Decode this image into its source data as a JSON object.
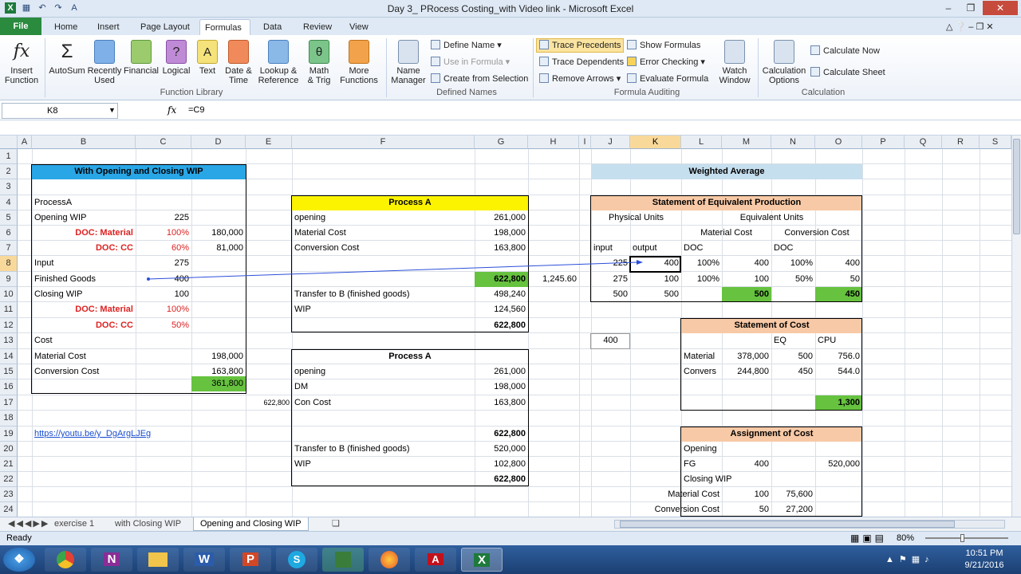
{
  "title": "Day 3_ PRocess Costing_with Video link - Microsoft Excel",
  "tabs": {
    "file": "File",
    "home": "Home",
    "insert": "Insert",
    "page_layout": "Page Layout",
    "formulas": "Formulas",
    "data": "Data",
    "review": "Review",
    "view": "View"
  },
  "ribbon": {
    "insert_function": "Insert\nFunction",
    "autosum": "AutoSum",
    "recently_used": "Recently\nUsed",
    "financial": "Financial",
    "logical": "Logical",
    "text": "Text",
    "date_time": "Date &\nTime",
    "lookup_ref": "Lookup &\nReference",
    "math_trig": "Math\n& Trig",
    "more_functions": "More\nFunctions",
    "name_manager": "Name\nManager",
    "define_name": "Define Name",
    "use_in_formula": "Use in Formula",
    "create_from_selection": "Create from Selection",
    "trace_precedents": "Trace Precedents",
    "trace_dependents": "Trace Dependents",
    "remove_arrows": "Remove Arrows",
    "show_formulas": "Show Formulas",
    "error_checking": "Error Checking",
    "evaluate_formula": "Evaluate Formula",
    "watch_window": "Watch\nWindow",
    "calc_options": "Calculation\nOptions",
    "calculate_now": "Calculate Now",
    "calculate_sheet": "Calculate Sheet",
    "grp_function_library": "Function Library",
    "grp_defined_names": "Defined Names",
    "grp_formula_auditing": "Formula Auditing",
    "grp_calculation": "Calculation"
  },
  "formula_bar": {
    "name_box": "K8",
    "fx": "fx",
    "formula": "=C9"
  },
  "columns": [
    "A",
    "B",
    "C",
    "D",
    "E",
    "F",
    "G",
    "H",
    "I",
    "J",
    "K",
    "L",
    "M",
    "N",
    "O",
    "P",
    "Q",
    "R",
    "S"
  ],
  "rows": [
    "1",
    "2",
    "3",
    "4",
    "5",
    "6",
    "7",
    "8",
    "9",
    "10",
    "11",
    "12",
    "13",
    "14",
    "15",
    "16",
    "17",
    "18",
    "19",
    "20",
    "21",
    "22",
    "23",
    "24"
  ],
  "left": {
    "title": "With Opening and Closing WIP",
    "r4": "ProcessA",
    "r5": "Opening WIP",
    "r5c": "225",
    "r6": "DOC: Material",
    "r6c": "100%",
    "r6d": "180,000",
    "r7": "DOC: CC",
    "r7c": "60%",
    "r7d": "81,000",
    "r8": "Input",
    "r8c": "275",
    "r9": "Finished Goods",
    "r9c": "400",
    "r10": "Closing WIP",
    "r10c": "100",
    "r11": "DOC: Material",
    "r11c": "100%",
    "r12": "DOC: CC",
    "r12c": "50%",
    "r13": "Cost",
    "r14": "Material Cost",
    "r14d": "198,000",
    "r15": "Conversion Cost",
    "r15d": "163,800",
    "r16d": "361,800",
    "link": "https://youtu.be/y_DgArgLJEg"
  },
  "proc1": {
    "title": "Process A",
    "r5": "opening",
    "r5g": "261,000",
    "r6": "Material Cost",
    "r6g": "198,000",
    "r7": "Conversion Cost",
    "r7g": "163,800",
    "r9g": "622,800",
    "r9h": "1,245.60",
    "r10": "Transfer to B (finished goods)",
    "r10g": "498,240",
    "r11": "WIP",
    "r11g": "124,560",
    "r12g": "622,800"
  },
  "proc2": {
    "title": "Process A",
    "r15": "opening",
    "r15g": "261,000",
    "r16": "DM",
    "r16g": "198,000",
    "r17e": "622,800",
    "r17": "Con Cost",
    "r17g": "163,800",
    "r19g": "622,800",
    "r20": "Transfer to B (finished goods)",
    "r20g": "520,000",
    "r21": "WIP",
    "r21g": "102,800",
    "r22g": "622,800"
  },
  "wa": {
    "title": "Weighted Average",
    "sep_title": "Statement of Equivalent Production",
    "physical_units": "Physical Units",
    "equivalent_units": "Equivalent Units",
    "material_cost": "Material Cost",
    "conversion_cost": "Conversion Cost",
    "input": "input",
    "output": "output",
    "doc1": "DOC",
    "doc2": "DOC",
    "r8": [
      "225",
      "400",
      "100%",
      "400",
      "100%",
      "400"
    ],
    "r9": [
      "275",
      "100",
      "100%",
      "100",
      "50%",
      "50"
    ],
    "r10": [
      "500",
      "500",
      "500",
      "450"
    ],
    "j13": "400",
    "soc_title": "Statement of Cost",
    "eq": "EQ",
    "cpu": "CPU",
    "r14": [
      "Material",
      "378,000",
      "500",
      "756.0"
    ],
    "r15": [
      "Convers",
      "244,800",
      "450",
      "544.0"
    ],
    "r17": "1,300",
    "aoc_title": "Assignment of Cost",
    "opening": "Opening",
    "fg": "FG",
    "fg_qty": "400",
    "fg_val": "520,000",
    "closing": "Closing WIP",
    "r23": [
      "Material Cost",
      "100",
      "75,600"
    ],
    "r24": [
      "Conversion Cost",
      "50",
      "27,200"
    ]
  },
  "sheets": [
    "exercise 1",
    "with Closing WIP",
    "Opening and Closing WIP"
  ],
  "status": {
    "ready": "Ready",
    "zoom": "80%"
  },
  "clock": {
    "time": "10:51 PM",
    "date": "9/21/2016"
  }
}
